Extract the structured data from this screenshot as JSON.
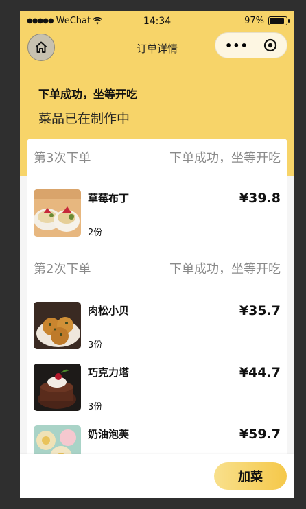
{
  "status_bar": {
    "carrier": "WeChat",
    "time": "14:34",
    "battery": "97%",
    "battery_level": 0.97
  },
  "nav": {
    "title": "订单详情",
    "home_icon": "home-icon",
    "more_icon": "more-dots-icon",
    "close_icon": "target-circle-icon"
  },
  "hero": {
    "title": "下单成功，坐等开吃",
    "subtitle": "菜品已在制作中"
  },
  "batches": [
    {
      "label": "第3次下单",
      "status": "下单成功，坐等开吃",
      "items": [
        {
          "name": "草莓布丁",
          "qty": "2份",
          "price": "¥39.8"
        }
      ]
    },
    {
      "label": "第2次下单",
      "status": "下单成功，坐等开吃",
      "items": [
        {
          "name": "肉松小贝",
          "qty": "3份",
          "price": "¥35.7"
        },
        {
          "name": "巧克力塔",
          "qty": "3份",
          "price": "¥44.7"
        },
        {
          "name": "奶油泡芙",
          "qty": "",
          "price": "¥59.7"
        }
      ]
    }
  ],
  "bottom": {
    "add_button": "加菜"
  },
  "colors": {
    "brand_yellow": "#f7d469",
    "button_gradient_start": "#f8e08c",
    "button_gradient_end": "#f5c84a"
  }
}
